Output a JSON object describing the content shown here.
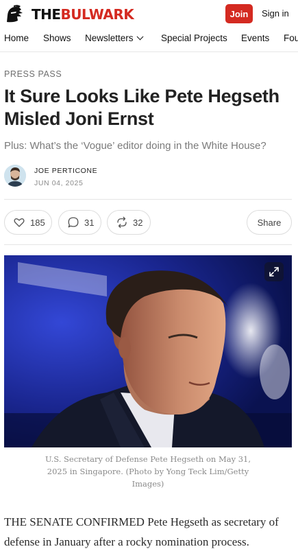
{
  "brand": {
    "logo_the": "THE",
    "logo_bulwark": "BULWARK",
    "accent_color": "#d42a21"
  },
  "header": {
    "join_label": "Join",
    "signin_label": "Sign in"
  },
  "nav": {
    "items": [
      "Home",
      "Shows",
      "Newsletters",
      "Special Projects",
      "Events",
      "Fou"
    ]
  },
  "article": {
    "kicker": "PRESS PASS",
    "title": "It Sure Looks Like Pete Hegseth Misled Joni Ernst",
    "subtitle": "Plus: What’s the ‘Vogue’ editor doing in the White House?",
    "author": "JOE PERTICONE",
    "date": "JUN 04, 2025",
    "likes": "185",
    "comments": "31",
    "restacks": "32",
    "share_label": "Share",
    "image_caption": "U.S. Secretary of Defense Pete Hegseth on May 31, 2025 in Singapore. (Photo by Yong Teck Lim/Getty Images)",
    "body_lead": "THE SENATE CONFIRMED",
    "body_rest": " Pete Hegseth as secretary of defense in January after a rocky nomination process."
  },
  "icons": {
    "logo": "knight-helmet-icon",
    "like": "heart-icon",
    "comment": "comment-bubble-icon",
    "restack": "restack-arrows-icon",
    "expand": "expand-icon",
    "nav_dropdown": "chevron-down-icon"
  }
}
